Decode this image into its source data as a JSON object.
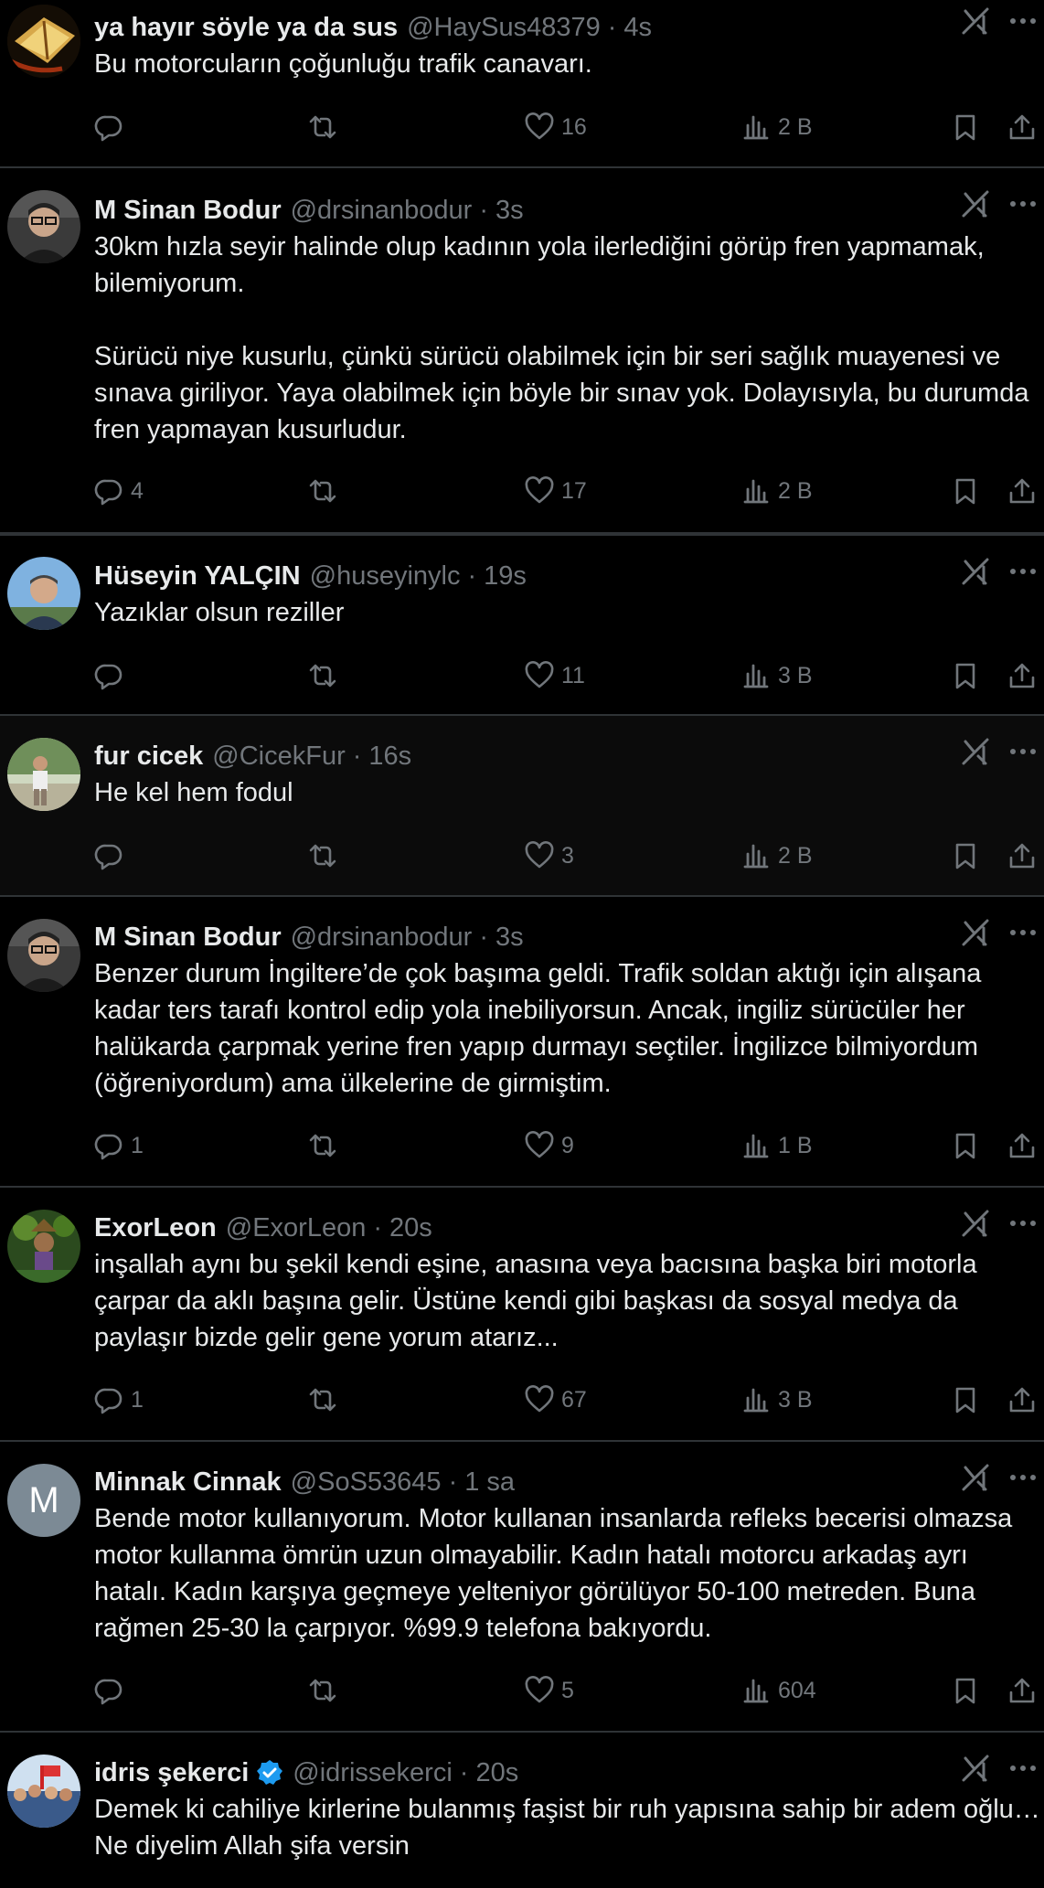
{
  "colors": {
    "background": "#000000",
    "text": "#e7e9ea",
    "muted": "#71767b",
    "divider": "#2f3336",
    "verified": "#1d9bf0"
  },
  "tweets": [
    {
      "name": "ya hayır söyle ya da sus",
      "handle": "@HaySus48379",
      "time": "4s",
      "text": "Bu motorcuların çoğunluğu trafik canavarı.",
      "replies": "",
      "likes": "16",
      "views": "2 B",
      "avatar": "book-avatar"
    },
    {
      "name": "M Sinan Bodur",
      "handle": "@drsinanbodur",
      "time": "3s",
      "text": "30km hızla seyir halinde olup kadının yola ilerlediğini görüp fren yapmamak, bilemiyorum.\n\nSürücü niye kusurlu, çünkü sürücü olabilmek için bir seri sağlık muayenesi ve sınava giriliyor. Yaya olabilmek için böyle bir sınav yok. Dolayısıyla, bu durumda fren yapmayan kusurludur.",
      "replies": "4",
      "likes": "17",
      "views": "2 B",
      "avatar": "man-glasses-avatar"
    },
    {
      "name": "Hüseyin YALÇIN",
      "handle": "@huseyinylc",
      "time": "19s",
      "text": "Yazıklar olsun reziller",
      "replies": "",
      "likes": "11",
      "views": "3 B",
      "avatar": "man-sky-avatar"
    },
    {
      "name": "fur cicek",
      "handle": "@CicekFur",
      "time": "16s",
      "text": "He kel hem fodul",
      "replies": "",
      "likes": "3",
      "views": "2 B",
      "avatar": "man-garden-avatar"
    },
    {
      "name": "M Sinan Bodur",
      "handle": "@drsinanbodur",
      "time": "3s",
      "text": "Benzer durum İngiltere’de çok başıma geldi. Trafik soldan aktığı için alışana kadar ters tarafı kontrol edip yola inebiliyorsun. Ancak, ingiliz sürücüler her halükarda çarpmak yerine fren yapıp durmayı seçtiler. İngilizce bilmiyordum (öğreniyordum) ama ülkelerine de girmiştim.",
      "replies": "1",
      "likes": "9",
      "views": "1 B",
      "avatar": "man-glasses-avatar"
    },
    {
      "name": "ExorLeon",
      "handle": "@ExorLeon",
      "time": "20s",
      "text": "inşallah aynı bu şekil kendi eşine, anasına veya bacısına başka biri motorla çarpar da aklı başına gelir. Üstüne kendi gibi başkası da sosyal medya da paylaşır bizde gelir gene yorum atarız...",
      "replies": "1",
      "likes": "67",
      "views": "3 B",
      "avatar": "game-character-avatar"
    },
    {
      "name": "Minnak Cinnak",
      "handle": "@SoS53645",
      "time": "1 sa",
      "text": "Bende motor kullanıyorum. Motor kullanan insanlarda refleks becerisi olmazsa motor kullanma ömrün uzun olmayabilir. Kadın hatalı motorcu arkadaş ayrı hatalı. Kadın karşıya geçmeye yelteniyor görülüyor 50-100 metreden. Buna rağmen 25-30 la çarpıyor. %99.9 telefona bakıyordu.",
      "replies": "",
      "likes": "5",
      "views": "604",
      "avatar": "letter-avatar",
      "avatar_letter": "M"
    },
    {
      "name": "idris şekerci",
      "handle": "@idrissekerci",
      "time": "20s",
      "text": "Demek ki cahiliye kirlerine bulanmış faşist bir ruh yapısına sahip bir adem oğlu… Ne diyelim Allah şifa versin",
      "replies": "",
      "likes": "",
      "views": "",
      "avatar": "crowd-avatar",
      "verified": true
    }
  ]
}
